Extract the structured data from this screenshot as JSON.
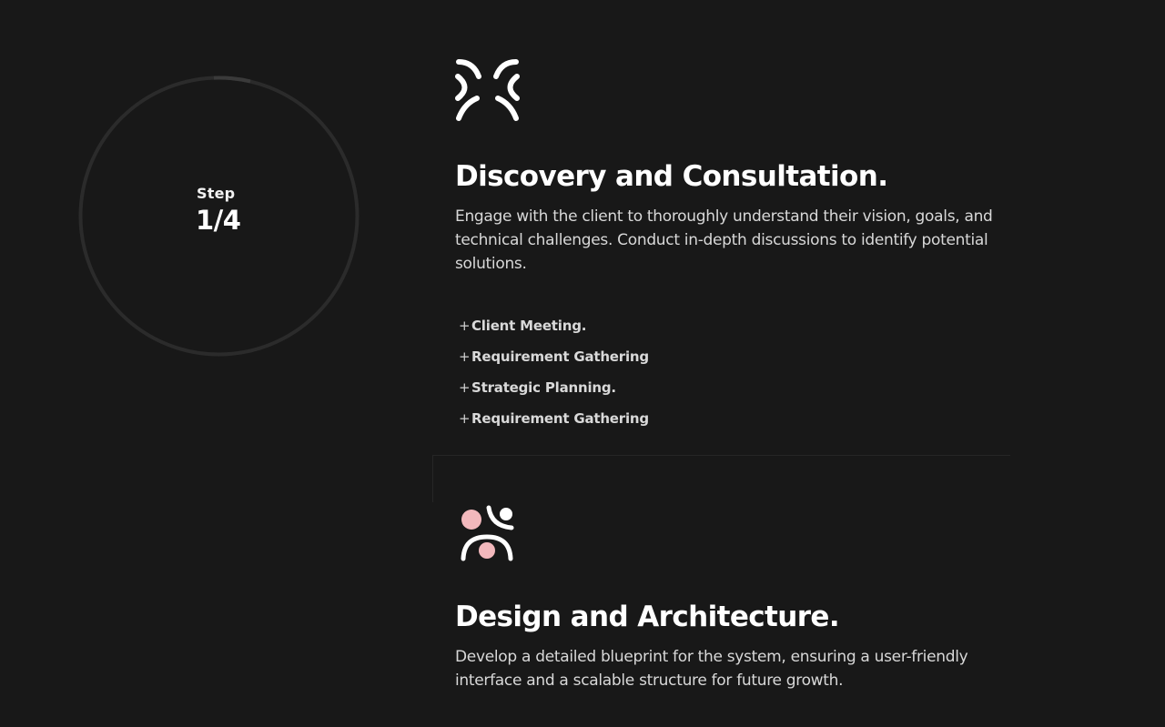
{
  "step": {
    "label": "Step",
    "count": "1/4",
    "progress_fraction": 0.02
  },
  "colors": {
    "background": "#181818",
    "ring": "#2b2b2b",
    "ring_progress": "#3a3a3a",
    "accent_pink": "#f2b8bc",
    "text": "#ffffff",
    "muted_text": "#d8d8d8"
  },
  "sections": [
    {
      "icon": "frustrated-face-icon",
      "title": "Discovery and Consultation.",
      "description": "Engage with the client to thoroughly understand their vision, goals, and technical challenges. Conduct in-depth discussions to identify potential solutions.",
      "items": [
        "Client Meeting.",
        "Requirement Gathering",
        "Strategic Planning.",
        "Requirement Gathering"
      ]
    },
    {
      "icon": "people-collaboration-icon",
      "title": "Design and Architecture.",
      "description": "Develop a detailed blueprint for the system, ensuring a user-friendly interface and a scalable structure for future growth.",
      "items": []
    }
  ],
  "plus_symbol": "+"
}
